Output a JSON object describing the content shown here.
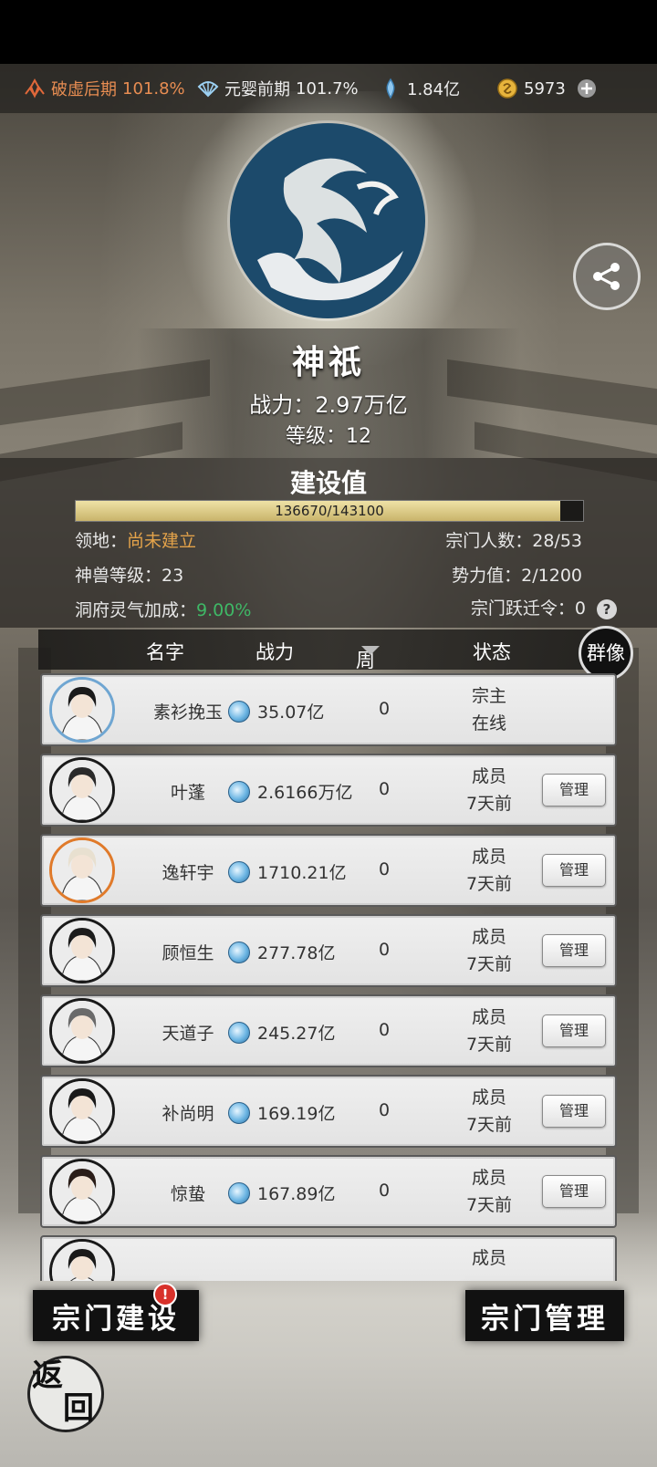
{
  "topbar": {
    "realm1": {
      "name": "破虚后期",
      "pct": "101.8%"
    },
    "realm2": {
      "name": "元婴前期",
      "pct": "101.7%"
    },
    "crystals": "1.84亿",
    "gold": "5973"
  },
  "sect": {
    "name": "神祇",
    "power_label": "战力：",
    "power": "2.97万亿",
    "level_label": "等级：",
    "level": "12"
  },
  "build": {
    "title": "建设值",
    "current": 136670,
    "max": 143100,
    "text": "136670/143100"
  },
  "stats": {
    "territory_label": "领地：",
    "territory": "尚未建立",
    "members_label": "宗门人数：",
    "members": "28/53",
    "beast_label": "神兽等级：",
    "beast": "23",
    "influence_label": "势力值：",
    "influence": "2/1200",
    "cave_label": "洞府灵气加成：",
    "cave": "9.00%",
    "migrate_label": "宗门跃迁令：",
    "migrate": "0",
    "help": "?"
  },
  "table": {
    "col_name": "名字",
    "col_power": "战力",
    "col_contrib": "周贡献",
    "col_status": "状态",
    "portrait_btn": "群像"
  },
  "members": [
    {
      "name": "素衫挽玉",
      "power": "35.07亿",
      "contrib": "0",
      "role": "宗主",
      "status": "在线",
      "manage": ""
    },
    {
      "name": "叶蓬",
      "power": "2.6166万亿",
      "contrib": "0",
      "role": "成员",
      "status": "7天前",
      "manage": "管理"
    },
    {
      "name": "逸轩宇",
      "power": "1710.21亿",
      "contrib": "0",
      "role": "成员",
      "status": "7天前",
      "manage": "管理"
    },
    {
      "name": "顾恒生",
      "power": "277.78亿",
      "contrib": "0",
      "role": "成员",
      "status": "7天前",
      "manage": "管理"
    },
    {
      "name": "天道子",
      "power": "245.27亿",
      "contrib": "0",
      "role": "成员",
      "status": "7天前",
      "manage": "管理"
    },
    {
      "name": "补尚明",
      "power": "169.19亿",
      "contrib": "0",
      "role": "成员",
      "status": "7天前",
      "manage": "管理"
    },
    {
      "name": "惊蛰",
      "power": "167.89亿",
      "contrib": "0",
      "role": "成员",
      "status": "7天前",
      "manage": "管理"
    },
    {
      "name": "",
      "power": "",
      "contrib": "",
      "role": "成员",
      "status": "",
      "manage": ""
    }
  ],
  "buttons": {
    "build": "宗门建设",
    "build_badge": "!",
    "manage": "宗门管理",
    "back_top": "返",
    "back_bottom": "回"
  },
  "colors": {
    "accent_orange": "#e88d52",
    "territory_orange": "#e4a34a",
    "green": "#3fb866",
    "emblem_blue": "#1c4a6b"
  }
}
